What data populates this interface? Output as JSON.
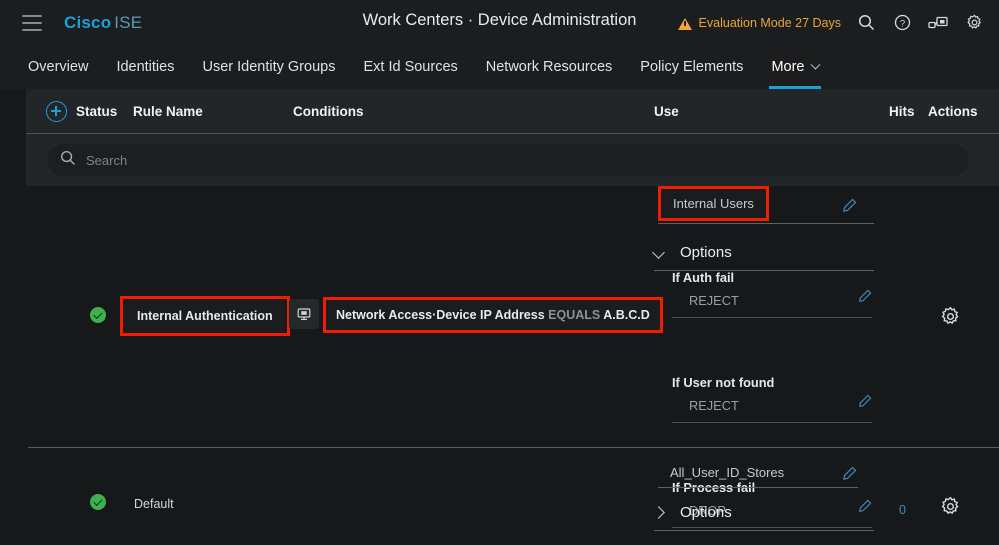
{
  "topbar": {
    "menu_icon": "hamburger-icon",
    "brand_primary": "Cisco",
    "brand_secondary": "ISE",
    "page_title": "Work Centers · Device Administration",
    "eval_badge": "Evaluation Mode 27 Days",
    "eval_color": "#e9a43a",
    "icons": [
      "search-icon",
      "help-icon",
      "dashboard-icon",
      "gear-icon"
    ]
  },
  "nav": {
    "items": [
      {
        "label": "Overview",
        "active": false
      },
      {
        "label": "Identities",
        "active": false
      },
      {
        "label": "User Identity Groups",
        "active": false
      },
      {
        "label": "Ext Id Sources",
        "active": false
      },
      {
        "label": "Network Resources",
        "active": false
      },
      {
        "label": "Policy Elements",
        "active": false
      },
      {
        "label": "More",
        "active": true
      }
    ],
    "active_color": "#1ba0d7"
  },
  "table": {
    "add_icon": "plus-circle-icon",
    "columns": {
      "status": "Status",
      "rule_name": "Rule Name",
      "conditions": "Conditions",
      "use": "Use",
      "hits": "Hits",
      "actions": "Actions"
    },
    "search": {
      "value": "",
      "placeholder": "Search",
      "icon": "search-icon"
    }
  },
  "rows": [
    {
      "status": "enabled",
      "rule_name": "Internal Authentication",
      "rule_name_highlighted": true,
      "condition_icon": "monitor-icon",
      "condition_prefix": "Network Access·Device IP Address",
      "condition_operator": "EQUALS",
      "condition_value": "A.B.C.D",
      "condition_highlighted": true,
      "use_value": "Internal Users",
      "use_highlighted": true,
      "options_label": "Options",
      "options_expanded": true,
      "options": [
        {
          "key": "If Auth fail",
          "value": "REJECT"
        },
        {
          "key": "If User not found",
          "value": "REJECT"
        },
        {
          "key": "If Process fail",
          "value": "DROP"
        }
      ],
      "hits": "",
      "actions_icon": "gear-icon"
    },
    {
      "status": "enabled",
      "rule_name": "Default",
      "rule_name_highlighted": false,
      "use_value": "All_User_ID_Stores",
      "use_highlighted": false,
      "options_label": "Options",
      "options_expanded": false,
      "options": [],
      "hits": "0",
      "actions_icon": "gear-icon"
    }
  ],
  "colors": {
    "background": "#16181a",
    "panel": "#232628",
    "accent": "#1ba0d7",
    "highlight_box": "#f01d05",
    "status_ok": "#3cb14e",
    "hits": "#3f8dbd"
  }
}
